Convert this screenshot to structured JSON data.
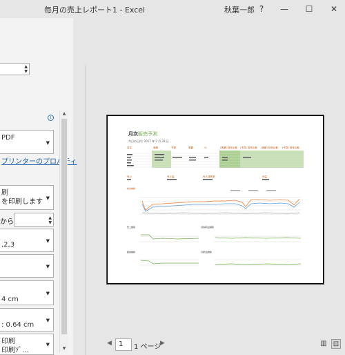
{
  "window": {
    "title": "毎月の売上レポート1  -  Excel",
    "user": "秋葉一郎",
    "help": "?",
    "minimize": "—",
    "maximize": "☐",
    "close": "✕"
  },
  "settings": {
    "printer_name": "PDF",
    "printer_props_link": "プリンターのプロパティ",
    "info_icon": "i",
    "print_what_line1": "刷",
    "print_what_line2": "を印刷します",
    "pages_from_label": "から",
    "collate_value": ",2,3",
    "margins_value1": "4 cm",
    "margins_value2": ": 0.64 cm",
    "scaling_line1": "印刷",
    "scaling_line2": "印刷ｿﾞ..."
  },
  "footer": {
    "current_page": "1",
    "page_total": "1 ページ"
  },
  "preview": {
    "title_prefix": "月次",
    "title_accent": "販売予測",
    "date": "今日の日付: 2017 年 2 月 28 日",
    "headers": [
      "月名",
      "実績",
      "予算",
      "差額",
      "%",
      "(実績) 前年比較",
      "(予算) 前年比較",
      "(実績) 前年比較",
      "(予算) 前年比較"
    ],
    "sub_headers": [
      "売上",
      "売上高",
      "売上成長率",
      "利益"
    ],
    "chart_label_main": "総合推移",
    "chart_labels_small": [
      "売上推移",
      "経常利益推移",
      "経常推移",
      "純利益推移"
    ]
  },
  "colors": {
    "accent_green": "#70ad47",
    "header_orange": "#c55a11",
    "table_green": "#c6e0b4"
  }
}
